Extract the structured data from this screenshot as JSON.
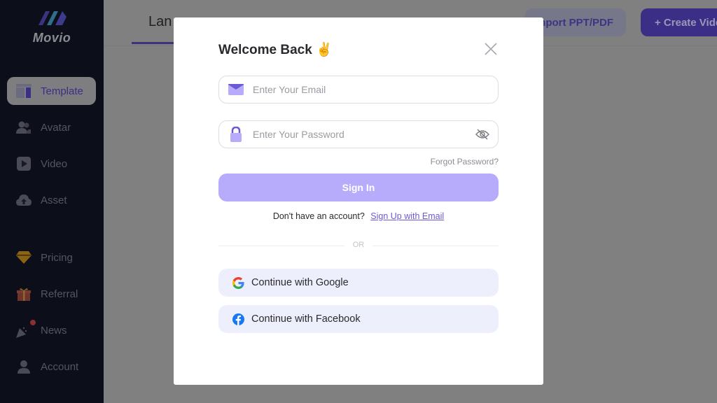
{
  "app": {
    "brand": "Movio"
  },
  "sidebar": {
    "items": [
      {
        "label": "Template",
        "icon": "template-icon",
        "active": true
      },
      {
        "label": "Avatar",
        "icon": "avatar-icon"
      },
      {
        "label": "Video",
        "icon": "video-icon"
      },
      {
        "label": "Asset",
        "icon": "cloud-upload-icon"
      },
      {
        "label": "Pricing",
        "icon": "diamond-icon"
      },
      {
        "label": "Referral",
        "icon": "gift-icon"
      },
      {
        "label": "News",
        "icon": "party-popper-icon",
        "badge": true
      },
      {
        "label": "Account",
        "icon": "user-icon"
      }
    ]
  },
  "header": {
    "tab_partial": "Lan",
    "import_label": "Import PPT/PDF",
    "create_label": "+ Create Video"
  },
  "modal": {
    "title": "Welcome Back",
    "title_emoji": "✌️",
    "email_placeholder": "Enter Your Email",
    "password_placeholder": "Enter Your Password",
    "forgot_label": "Forgot Password?",
    "signin_label": "Sign In",
    "no_account_text": "Don't have an account?",
    "signup_label": "Sign Up with Email",
    "or_label": "OR",
    "google_label": "Continue with Google",
    "facebook_label": "Continue with Facebook"
  },
  "colors": {
    "accent": "#5b47e0",
    "signin_bg": "#b6acfb",
    "social_bg": "#eeeffd",
    "link": "#6b5ad8",
    "overlay": "#808080"
  }
}
